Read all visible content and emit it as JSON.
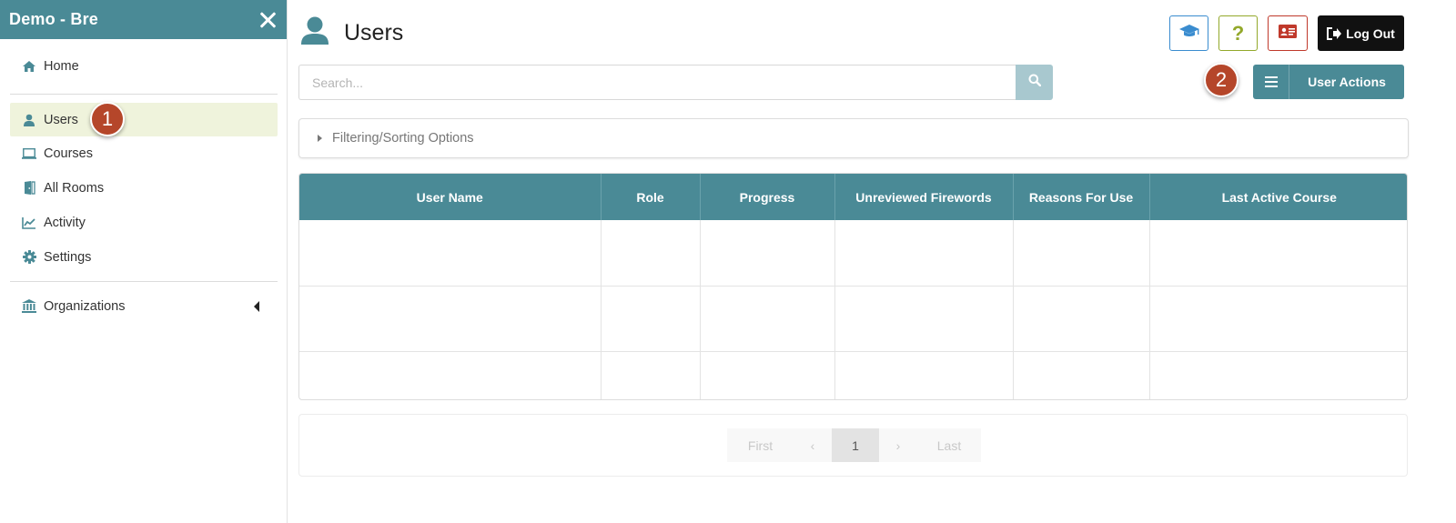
{
  "sidebar": {
    "title": "Demo - Bre",
    "items": [
      {
        "label": "Home",
        "icon": "home-icon"
      },
      {
        "label": "Users",
        "icon": "user-icon"
      },
      {
        "label": "Courses",
        "icon": "monitor-icon"
      },
      {
        "label": "All Rooms",
        "icon": "door-icon"
      },
      {
        "label": "Activity",
        "icon": "line-chart-icon"
      },
      {
        "label": "Settings",
        "icon": "gear-icon"
      },
      {
        "label": "Organizations",
        "icon": "institution-icon"
      }
    ]
  },
  "callouts": [
    "1",
    "2"
  ],
  "header": {
    "title": "Users",
    "logout_label": "Log Out",
    "help_glyph": "?"
  },
  "search": {
    "placeholder": "Search...",
    "value": ""
  },
  "user_actions_label": "User Actions",
  "filter_label": "Filtering/Sorting Options",
  "table": {
    "columns": [
      "User Name",
      "Role",
      "Progress",
      "Unreviewed Firewords",
      "Reasons For Use",
      "Last Active Course"
    ]
  },
  "pagination": {
    "first": "First",
    "prev": "‹",
    "current": "1",
    "next": "›",
    "last": "Last"
  },
  "colors": {
    "accent": "#4a8a96",
    "active_bg": "#eff3dc",
    "badge": "#b5462a"
  }
}
